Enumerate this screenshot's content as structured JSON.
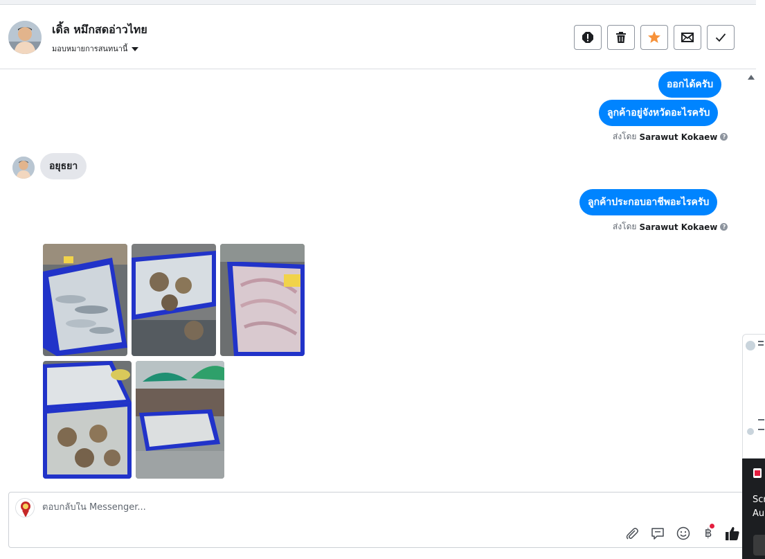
{
  "header": {
    "contact_name": "เดิ้ล หมึกสดอ่าวไทย",
    "assign_label": "มอบหมายการสนทนานี้",
    "actions": [
      "spam-icon",
      "trash-icon",
      "star-icon",
      "mail-icon",
      "check-icon"
    ],
    "star_color": "#f7923a"
  },
  "messages": {
    "out_1": "ออกได้ครับ",
    "out_2": "ลูกค้าอยู่จังหวัดอะไรครับ",
    "sent_by_prefix": "ส่งโดย",
    "sent_by_name": "Sarawut Kokaew",
    "in_1": "อยุธยา",
    "out_3": "ลูกค้าประกอบอาชีพอะไรครับ",
    "photos": [
      "seafood-photo-1",
      "seafood-photo-2",
      "seafood-photo-3",
      "seafood-photo-4",
      "seafood-photo-5"
    ]
  },
  "composer": {
    "placeholder": "ตอบกลับใน Messenger...",
    "tools": [
      "paperclip-icon",
      "speech-bubble-icon",
      "smiley-icon",
      "baht-icon",
      "thumbs-up-icon"
    ],
    "baht_symbol": "฿"
  },
  "side_panel": {
    "text_1": "Scr",
    "text_2": "Au"
  },
  "colors": {
    "accent": "#0084ff",
    "incoming_bubble": "#e4e6eb",
    "notification_dot": "#e41e3f"
  }
}
